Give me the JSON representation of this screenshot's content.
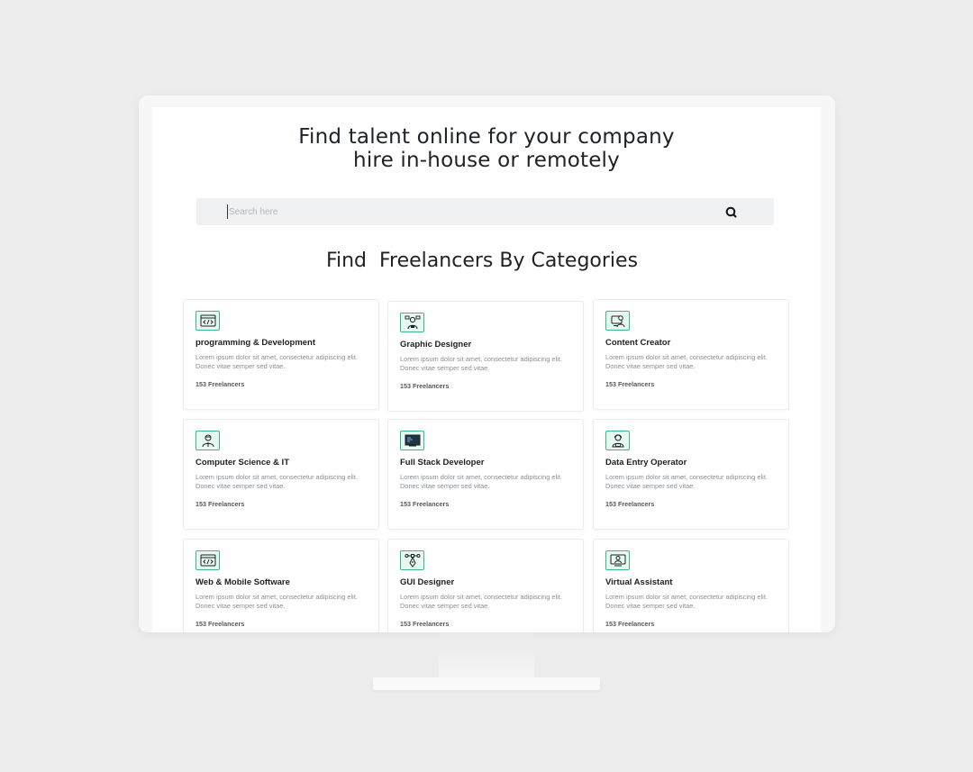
{
  "hero": {
    "line1": "Find talent online for your company",
    "line2": "hire in-house or remotely"
  },
  "search": {
    "placeholder": "Search here",
    "icon": "search-icon"
  },
  "section": {
    "title": "Find  Freelancers By Categories"
  },
  "categories": [
    {
      "title": "programming & Development",
      "description": "Lorem ipsum dolor sit amet, consectetur adipiscing elit. Donec vitae semper sed vitae.",
      "count": "153 Freelancers",
      "icon": "code-window-icon"
    },
    {
      "title": "Graphic Designer",
      "description": "Lorem ipsum dolor sit amet, consectetur adipiscing elit. Donec vitae semper sed vitae.",
      "count": "153 Freelancers",
      "icon": "designer-icon"
    },
    {
      "title": "Content Creator",
      "description": "Lorem ipsum dolor sit amet, consectetur adipiscing elit. Donec vitae semper sed vitae.",
      "count": "153 Freelancers",
      "icon": "content-creator-icon"
    },
    {
      "title": "Computer Science & IT",
      "description": "Lorem ipsum dolor sit amet, consectetur adipiscing elit. Donec vitae semper sed vitae.",
      "count": "153 Freelancers",
      "icon": "computer-scientist-icon"
    },
    {
      "title": "Full Stack Developer",
      "description": "Lorem ipsum dolor sit amet, consectetur adipiscing elit. Donec vitae semper sed vitae.",
      "count": "153 Freelancers",
      "icon": "monitor-icon"
    },
    {
      "title": "Data Entry Operator",
      "description": "Lorem ipsum dolor sit amet, consectetur adipiscing elit. Donec vitae semper sed vitae.",
      "count": "153 Freelancers",
      "icon": "operator-icon"
    },
    {
      "title": "Web & Mobile Software",
      "description": "Lorem ipsum dolor sit amet, consectetur adipiscing elit. Donec vitae semper sed vitae.",
      "count": "153 Freelancers",
      "icon": "code-window-icon"
    },
    {
      "title": "GUI Designer",
      "description": "Lorem ipsum dolor sit amet, consectetur adipiscing elit. Donec vitae semper sed vitae.",
      "count": "153 Freelancers",
      "icon": "vector-pen-icon"
    },
    {
      "title": "Virtual Assistant",
      "description": "Lorem ipsum dolor sit amet, consectetur adipiscing elit. Donec vitae semper sed vitae.",
      "count": "153 Freelancers",
      "icon": "assistant-icon"
    }
  ],
  "colors": {
    "accent": "#3cb88a",
    "icon_bg": "#e7f8f1",
    "text_dark": "#1e2227",
    "text_muted": "#8b8f94",
    "search_bg": "#f0f1f3"
  }
}
